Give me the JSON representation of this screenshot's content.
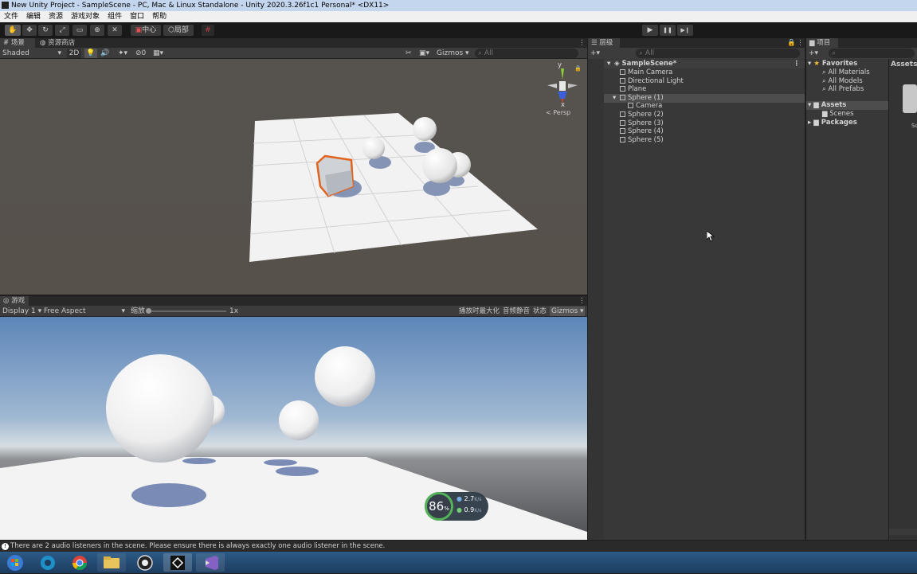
{
  "window": {
    "title": "New Unity Project - SampleScene - PC, Mac & Linux Standalone - Unity 2020.3.26f1c1 Personal* <DX11>"
  },
  "menu": [
    "文件",
    "编辑",
    "资源",
    "游戏对象",
    "组件",
    "窗口",
    "帮助"
  ],
  "toolbar": {
    "pivot_label": "中心",
    "space_label": "局部",
    "tools": [
      "hand-tool-icon",
      "move-tool-icon",
      "rotate-tool-icon",
      "scale-tool-icon",
      "rect-tool-icon",
      "transform-tool-icon",
      "custom-tool-icon"
    ],
    "play": "▶",
    "pause": "❚❚",
    "step": "▶❙"
  },
  "scene": {
    "tabs": [
      "场景",
      "资源商店"
    ],
    "shading": "Shaded",
    "mode_2d": "2D",
    "gizmos": "Gizmos",
    "search_placeholder": "All",
    "fx_count": "0",
    "persp": "< Persp",
    "axes": {
      "y": "y",
      "x": "x"
    }
  },
  "game": {
    "tab": "游戏",
    "display": "Display 1",
    "aspect": "Free Aspect",
    "scale_label": "缩放",
    "scale_value": "1x",
    "maximize_label": "播放时最大化",
    "mute_label": "音频静音",
    "stats_label": "状态",
    "gizmos": "Gizmos",
    "overlay": {
      "percent": "86",
      "percent_unit": "%",
      "up": "2.7",
      "down": "0.9",
      "rate_unit": "K/s"
    }
  },
  "hierarchy": {
    "tab": "层级",
    "search_placeholder": "All",
    "scene_name": "SampleScene*",
    "items": [
      {
        "label": "Main Camera",
        "depth": 1
      },
      {
        "label": "Directional Light",
        "depth": 1
      },
      {
        "label": "Plane",
        "depth": 1
      },
      {
        "label": "Sphere (1)",
        "depth": 1,
        "selected": true,
        "expanded": true
      },
      {
        "label": "Camera",
        "depth": 2
      },
      {
        "label": "Sphere (2)",
        "depth": 1
      },
      {
        "label": "Sphere (3)",
        "depth": 1
      },
      {
        "label": "Sphere (4)",
        "depth": 1
      },
      {
        "label": "Sphere (5)",
        "depth": 1
      }
    ]
  },
  "project": {
    "tab": "项目",
    "favorites_label": "Favorites",
    "favorites": [
      "All Materials",
      "All Models",
      "All Prefabs"
    ],
    "assets_label": "Assets",
    "assets_children": [
      "Scenes"
    ],
    "packages_label": "Packages",
    "breadcrumb": "Assets",
    "right_label": "Sc"
  },
  "status": {
    "message": "There are 2 audio listeners in the scene. Please ensure there is always exactly one audio listener in the scene."
  },
  "taskbar": {
    "apps": [
      "windows-start-icon",
      "edge-icon",
      "chrome-icon",
      "file-explorer-icon",
      "obs-icon",
      "unity-icon",
      "visual-studio-icon"
    ]
  },
  "colors": {
    "accent_selected": "#4d4d4d",
    "selection_outline": "#e0641e",
    "favorites_star": "#f0c030"
  }
}
